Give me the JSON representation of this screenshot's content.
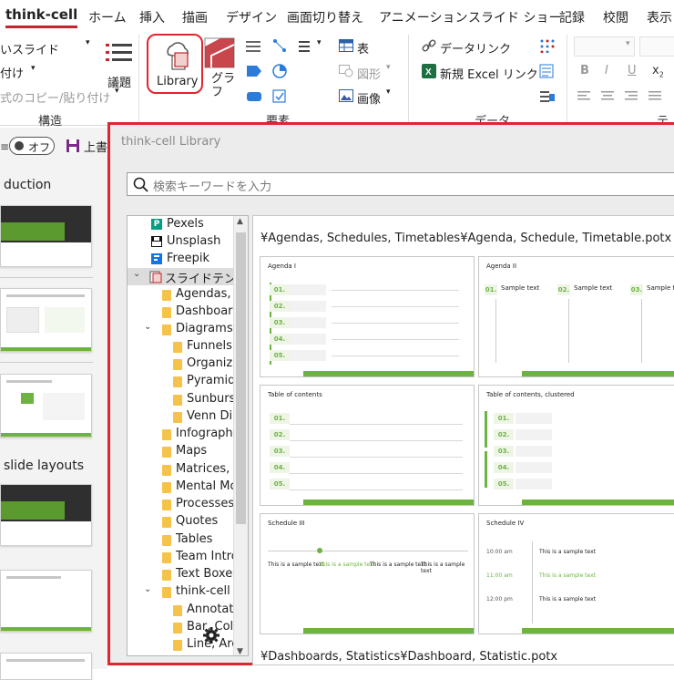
{
  "tabs": {
    "thinkcell": "think-cell",
    "home": "ホーム",
    "insert": "挿入",
    "draw": "描画",
    "design": "デザイン",
    "transitions": "画面切り替え",
    "animations": "アニメーション",
    "slideshow": "スライド ショー",
    "record": "記録",
    "review": "校閲",
    "view": "表示"
  },
  "ribbon": {
    "new_slide": "いスライド",
    "layout": "付け",
    "copy_paste": "式のコピー/貼り付け",
    "agenda": "議題",
    "library": "Library",
    "graph": "グラ\nフ",
    "table": "表",
    "shape": "図形",
    "image": "画像",
    "data_link": "データリンク",
    "new_excel_link": "新規 Excel リンク",
    "groups": {
      "structure": "構造",
      "elements": "要素",
      "data": "データ",
      "text": "テキ"
    }
  },
  "left_panel": {
    "toggle_label": "オフ",
    "save_label": "上書",
    "sections": [
      "duction",
      "slide layouts"
    ]
  },
  "dialog": {
    "title": "think-cell Library",
    "search_placeholder": "検索キーワードを入力",
    "path": "¥Agendas, Schedules, Timetables¥Agenda, Schedule, Timetable.potx",
    "next_path": "¥Dashboards, Statistics¥Dashboard, Statistic.potx",
    "tree": [
      "Pexels",
      "Unsplash",
      "Freepik",
      "スライドテンプレ",
      "Agendas, S",
      "Dashboard",
      "Diagrams",
      "Funnels",
      "Organiz",
      "Pyramids",
      "Sunburst",
      "Venn Dia",
      "Infographi",
      "Maps",
      "Matrices, S",
      "Mental Mo",
      "Processes,",
      "Quotes",
      "Tables",
      "Team Intro",
      "Text Boxes",
      "think-cell C",
      "Annotati",
      "Bar, Colu",
      "Line, Are"
    ],
    "templates": [
      "Agenda I",
      "Agenda II",
      "Table of contents",
      "Table of contents, clustered",
      "Schedule III",
      "Schedule IV"
    ],
    "row_numbers": [
      "01.",
      "02.",
      "03.",
      "04.",
      "05."
    ],
    "sample_text": "Sample text",
    "example_text": "This is a sample text",
    "times": [
      "10:00 am",
      "11:00 am",
      "12:00 pm"
    ]
  },
  "colors": {
    "accent_red": "#e0252f",
    "green": "#6db33f",
    "folder": "#f6c34a"
  }
}
